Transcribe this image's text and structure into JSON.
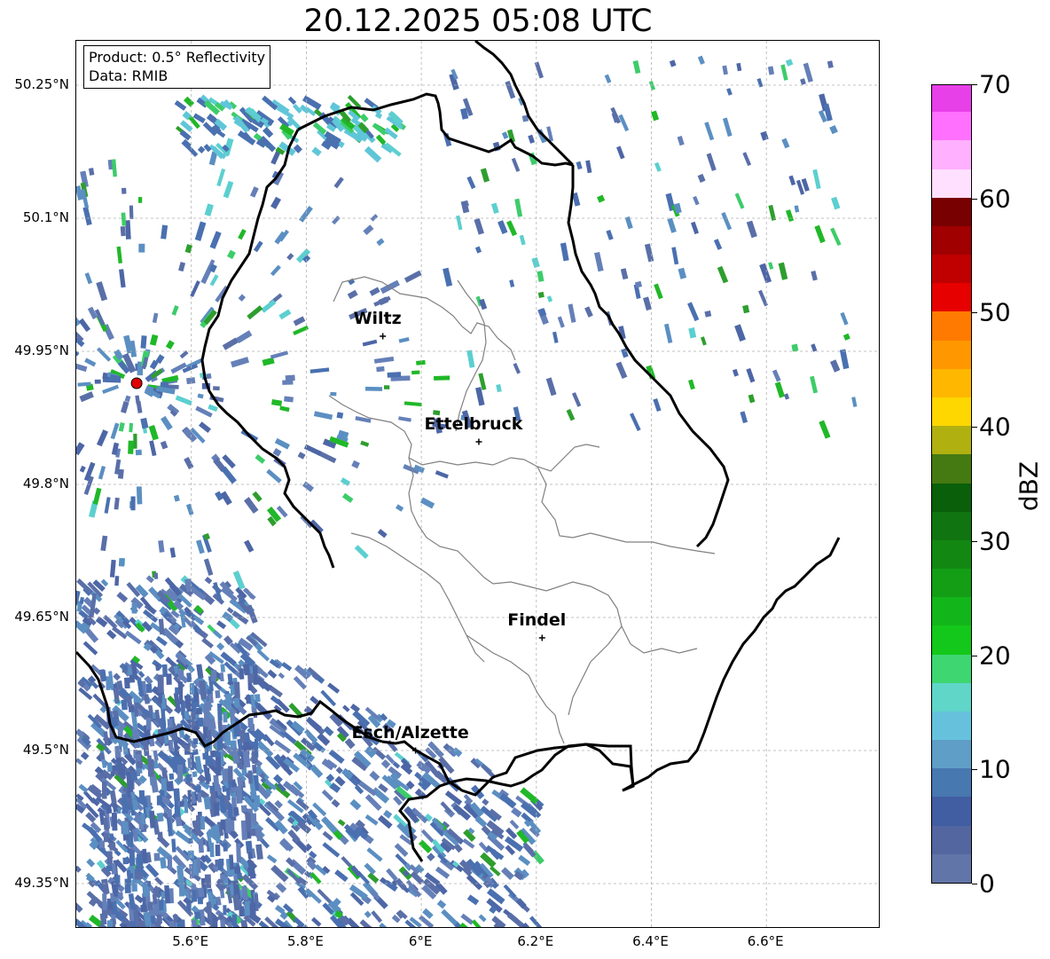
{
  "title": "20.12.2025 05:08 UTC",
  "info_box": {
    "product": "Product: 0.5° Reflectivity",
    "data": "Data: RMIB"
  },
  "map": {
    "lon_range": [
      5.4,
      6.8
    ],
    "lat_range": [
      49.3,
      50.3
    ],
    "lat_ticks": [
      {
        "value": 50.25,
        "label": "50.25°N"
      },
      {
        "value": 50.1,
        "label": "50.1°N"
      },
      {
        "value": 49.95,
        "label": "49.95°N"
      },
      {
        "value": 49.8,
        "label": "49.8°N"
      },
      {
        "value": 49.65,
        "label": "49.65°N"
      },
      {
        "value": 49.5,
        "label": "49.5°N"
      },
      {
        "value": 49.35,
        "label": "49.35°N"
      }
    ],
    "lon_ticks": [
      {
        "value": 5.6,
        "label": "5.6°E"
      },
      {
        "value": 5.8,
        "label": "5.8°E"
      },
      {
        "value": 6.0,
        "label": "6°E"
      },
      {
        "value": 6.2,
        "label": "6.2°E"
      },
      {
        "value": 6.4,
        "label": "6.4°E"
      },
      {
        "value": 6.6,
        "label": "6.6°E"
      }
    ],
    "radar_site": {
      "lon": 5.505,
      "lat": 49.914
    },
    "cities": [
      {
        "name": "Wiltz",
        "lon": 5.933,
        "lat": 49.967
      },
      {
        "name": "Ettelbruck",
        "lon": 6.1,
        "lat": 49.848
      },
      {
        "name": "Findel",
        "lon": 6.21,
        "lat": 49.627
      },
      {
        "name": "Esch/Alzette",
        "lon": 5.99,
        "lat": 49.5
      }
    ]
  },
  "colorbar": {
    "label": "dBZ",
    "min": 0,
    "max": 70,
    "ticks": [
      {
        "value": 0,
        "label": "0"
      },
      {
        "value": 10,
        "label": "10"
      },
      {
        "value": 20,
        "label": "20"
      },
      {
        "value": 30,
        "label": "30"
      },
      {
        "value": 40,
        "label": "40"
      },
      {
        "value": 50,
        "label": "50"
      },
      {
        "value": 60,
        "label": "60"
      },
      {
        "value": 70,
        "label": "70"
      }
    ],
    "colors": [
      "#6275a8",
      "#54669f",
      "#425ea3",
      "#4878b0",
      "#5e9ec7",
      "#66c2dc",
      "#5fd6c8",
      "#3dd670",
      "#13c81a",
      "#13b61a",
      "#139e16",
      "#128812",
      "#107510",
      "#0a5f0a",
      "#457a12",
      "#b0b010",
      "#ffd700",
      "#ffb700",
      "#ff9800",
      "#ff7a00",
      "#e60000",
      "#c00000",
      "#a00000",
      "#780000",
      "#ffe0ff",
      "#ffb0ff",
      "#ff70ff",
      "#e840e8"
    ]
  },
  "colors": {
    "border": "#000000",
    "canton": "#808080",
    "grid": "#b0b0b0",
    "radar_marker": "#e00000"
  }
}
